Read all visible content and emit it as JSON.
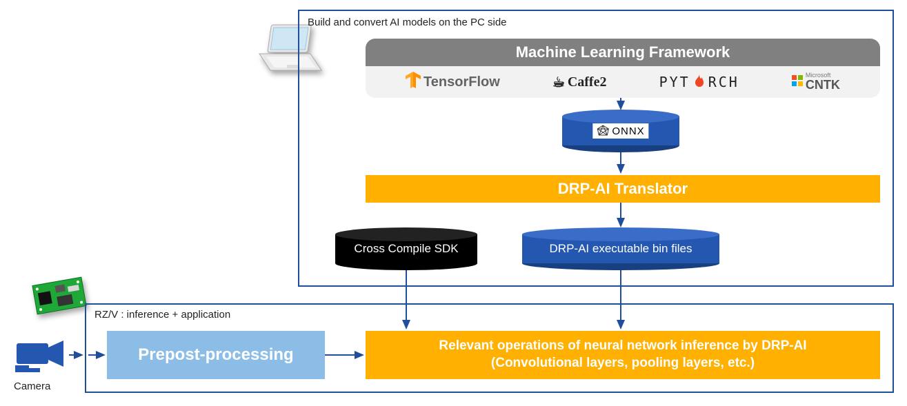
{
  "pc_side": {
    "title": "Build and convert AI models on the PC side",
    "ml_framework": {
      "header": "Machine Learning Framework",
      "logos": {
        "tensorflow": "TensorFlow",
        "caffe2": "Caffe2",
        "pytorch_pre": "PYT",
        "pytorch_post": "RCH",
        "cntk_ms": "Microsoft",
        "cntk": "CNTK"
      }
    },
    "onnx": "ONNX",
    "translator": "DRP-AI Translator",
    "sdk": "Cross Compile SDK",
    "bin_files": "DRP-AI executable bin files"
  },
  "rzv": {
    "title": "RZ/V : inference + application",
    "prepost": "Prepost-processing",
    "inference_line1": "Relevant operations of neural network inference by DRP-AI",
    "inference_line2": "(Convolutional layers, pooling layers, etc.)"
  },
  "camera": "Camera",
  "colors": {
    "darkblue": "#1F4E9B",
    "cylblue": "#2457B0",
    "amber": "#FFB000",
    "lightblue": "#8CBDE6",
    "grey": "#808080"
  }
}
